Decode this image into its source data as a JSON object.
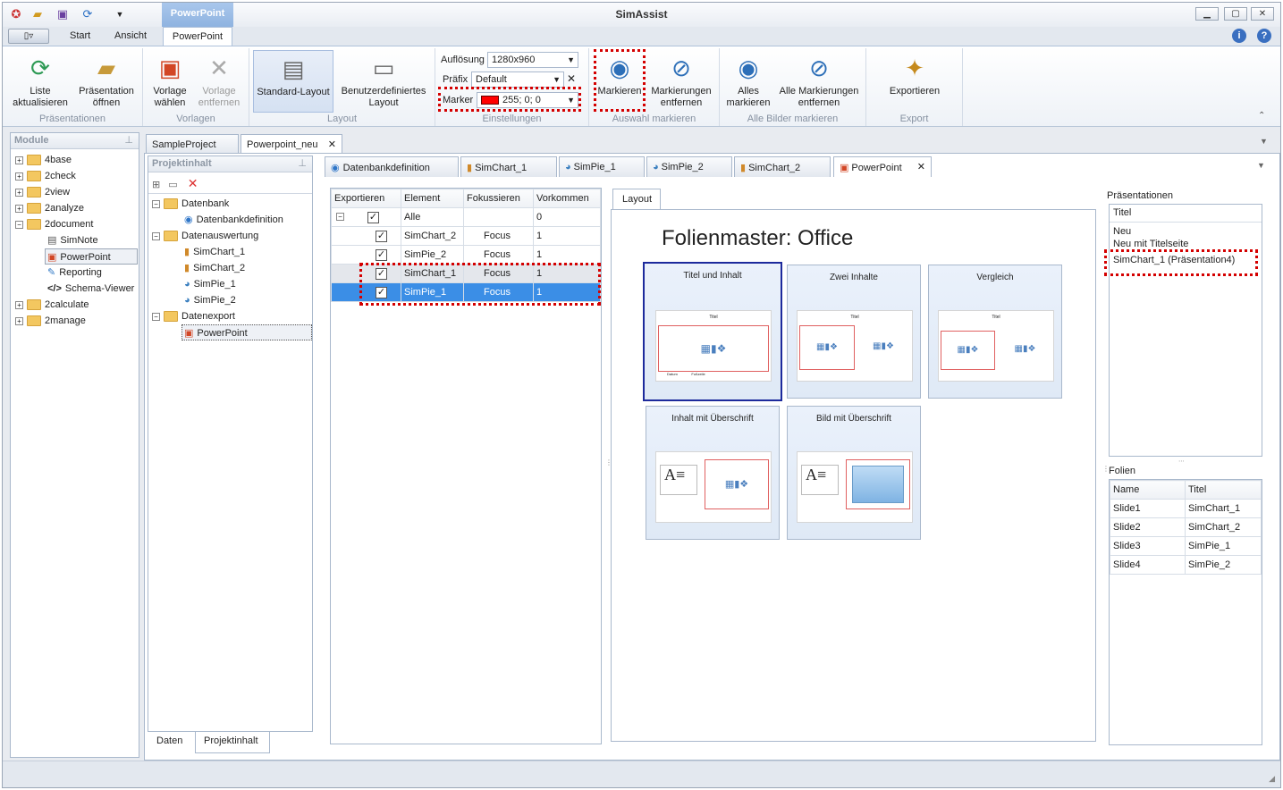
{
  "window": {
    "title": "SimAssist",
    "context_tab": "PowerPoint",
    "min": "▁",
    "max": "▢",
    "close": "✕"
  },
  "ribbon_tabs": {
    "start": "Start",
    "view": "Ansicht",
    "powerpoint": "PowerPoint"
  },
  "ribbon": {
    "refresh": "Liste aktualisieren",
    "open_pres": "Präsentation öffnen",
    "grp_pres": "Präsentationen",
    "choose_tpl": "Vorlage wählen",
    "remove_tpl": "Vorlage entfernen",
    "grp_tpl": "Vorlagen",
    "std_layout": "Standard-Layout",
    "custom_layout": "Benutzerdefiniertes Layout",
    "grp_layout": "Layout",
    "res_label": "Auflösung",
    "res_value": "1280x960",
    "prefix_label": "Präfix",
    "prefix_value": "Default",
    "marker_label": "Marker",
    "marker_value": "255; 0; 0",
    "grp_settings": "Einstellungen",
    "mark": "Markieren",
    "unmark": "Markierungen entfernen",
    "grp_sel": "Auswahl markieren",
    "mark_all": "Alles markieren",
    "unmark_all": "Alle Markierungen entfernen",
    "grp_all": "Alle Bilder markieren",
    "export": "Exportieren",
    "grp_export": "Export"
  },
  "modules": {
    "title": "Module",
    "items": [
      "4base",
      "2check",
      "2view",
      "2analyze",
      "2document",
      "SimNote",
      "PowerPoint",
      "Reporting",
      "Schema-Viewer",
      "2calculate",
      "2manage"
    ]
  },
  "project": {
    "title": "Projektinhalt",
    "items": [
      "Datenbank",
      "Datenbankdefinition",
      "Datenauswertung",
      "SimChart_1",
      "SimChart_2",
      "SimPie_1",
      "SimPie_2",
      "Datenexport",
      "PowerPoint"
    ],
    "tab_data": "Daten",
    "tab_content": "Projektinhalt"
  },
  "doctabs": [
    "SampleProject",
    "Powerpoint_neu"
  ],
  "subtabs": [
    "Datenbankdefinition",
    "SimChart_1",
    "SimPie_1",
    "SimPie_2",
    "SimChart_2",
    "PowerPoint"
  ],
  "export_table": {
    "headers": [
      "Exportieren",
      "Element",
      "Fokussieren",
      "Vorkommen"
    ],
    "rows": [
      {
        "el": "Alle",
        "focus": "",
        "count": "0"
      },
      {
        "el": "SimChart_2",
        "focus": "Focus",
        "count": "1"
      },
      {
        "el": "SimPie_2",
        "focus": "Focus",
        "count": "1"
      },
      {
        "el": "SimChart_1",
        "focus": "Focus",
        "count": "1"
      },
      {
        "el": "SimPie_1",
        "focus": "Focus",
        "count": "1"
      }
    ]
  },
  "layout": {
    "tab": "Layout",
    "master": "Folienmaster: Office",
    "slides": [
      "Titel und Inhalt",
      "Zwei Inhalte",
      "Vergleich",
      "Inhalt mit Überschrift",
      "Bild mit Überschrift"
    ],
    "mini_title": "Titel",
    "mini_date": "Datum",
    "mini_footer": "Fußzeile"
  },
  "presentations": {
    "title": "Präsentationen",
    "header": "Titel",
    "items": [
      "Neu",
      "Neu mit Titelseite",
      "SimChart_1 (Präsentation4)"
    ]
  },
  "slides_panel": {
    "title": "Folien",
    "headers": [
      "Name",
      "Titel"
    ],
    "rows": [
      [
        "Slide1",
        "SimChart_1"
      ],
      [
        "Slide2",
        "SimChart_2"
      ],
      [
        "Slide3",
        "SimPie_1"
      ],
      [
        "Slide4",
        "SimPie_2"
      ]
    ]
  },
  "colors": {
    "marker": "#ff0000",
    "accent": "#3b8ee6",
    "highlight": "#d40000"
  }
}
